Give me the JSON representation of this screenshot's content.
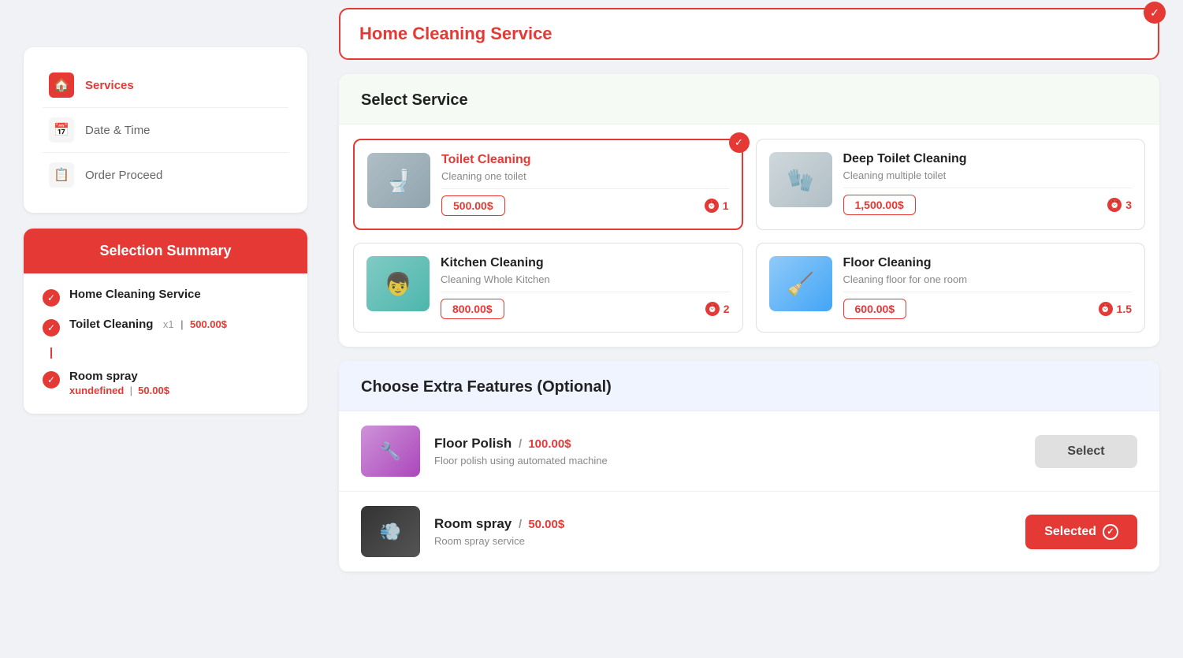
{
  "sidebar": {
    "nav": {
      "items": [
        {
          "id": "services",
          "label": "Services",
          "active": true
        },
        {
          "id": "datetime",
          "label": "Date & Time",
          "active": false
        },
        {
          "id": "order",
          "label": "Order Proceed",
          "active": false
        }
      ]
    },
    "summary": {
      "title": "Selection Summary",
      "items": [
        {
          "id": "home-cleaning",
          "name": "Home Cleaning Service",
          "detail": null
        },
        {
          "id": "toilet-cleaning",
          "name": "Toilet Cleaning",
          "quantity": "x1",
          "price": "500.00$"
        },
        {
          "id": "room-spray",
          "name": "Room spray",
          "quantity": "xundefined",
          "price": "50.00$"
        }
      ]
    }
  },
  "main": {
    "banner": {
      "title": "Home Cleaning Service",
      "selected": true
    },
    "select_service": {
      "section_title": "Select Service",
      "services": [
        {
          "id": "toilet-cleaning",
          "name": "Toilet Cleaning",
          "description": "Cleaning one toilet",
          "price": "500.00$",
          "time": "1",
          "selected": true,
          "color": "red"
        },
        {
          "id": "deep-toilet-cleaning",
          "name": "Deep Toilet Cleaning",
          "description": "Cleaning multiple toilet",
          "price": "1,500.00$",
          "time": "3",
          "selected": false,
          "color": "dark"
        },
        {
          "id": "kitchen-cleaning",
          "name": "Kitchen Cleaning",
          "description": "Cleaning Whole Kitchen",
          "price": "800.00$",
          "time": "2",
          "selected": false,
          "color": "dark"
        },
        {
          "id": "floor-cleaning",
          "name": "Floor Cleaning",
          "description": "Cleaning floor for one room",
          "price": "600.00$",
          "time": "1.5",
          "selected": false,
          "color": "dark"
        }
      ]
    },
    "extra_features": {
      "section_title": "Choose Extra Features (Optional)",
      "items": [
        {
          "id": "floor-polish",
          "name": "Floor Polish",
          "price": "100.00$",
          "description": "Floor polish using automated machine",
          "button_label": "Select",
          "selected": false
        },
        {
          "id": "room-spray",
          "name": "Room spray",
          "price": "50.00$",
          "description": "Room spray service",
          "button_label": "Selected",
          "selected": true
        }
      ]
    }
  }
}
